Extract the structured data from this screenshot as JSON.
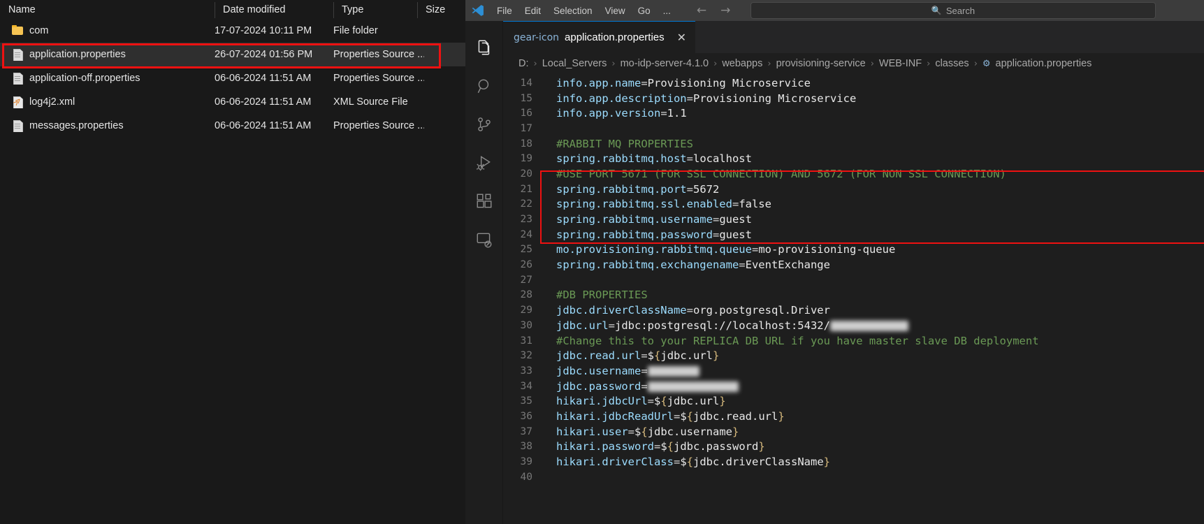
{
  "explorer": {
    "columns": [
      {
        "label": "Name"
      },
      {
        "label": "Date modified"
      },
      {
        "label": "Type"
      },
      {
        "label": "Size"
      }
    ],
    "rows": [
      {
        "name": "com",
        "date": "17-07-2024 10:11 PM",
        "type": "File folder",
        "size": "",
        "icon": "folder-icon",
        "selected": false
      },
      {
        "name": "application.properties",
        "date": "26-07-2024 01:56 PM",
        "type": "Properties Source ...",
        "size": "",
        "icon": "document-icon",
        "selected": true
      },
      {
        "name": "application-off.properties",
        "date": "06-06-2024 11:51 AM",
        "type": "Properties Source ...",
        "size": "",
        "icon": "document-icon",
        "selected": false
      },
      {
        "name": "log4j2.xml",
        "date": "06-06-2024 11:51 AM",
        "type": "XML Source File",
        "size": "",
        "icon": "xml-icon",
        "selected": false
      },
      {
        "name": "messages.properties",
        "date": "06-06-2024 11:51 AM",
        "type": "Properties Source ...",
        "size": "",
        "icon": "document-icon",
        "selected": false
      }
    ]
  },
  "vscode": {
    "menu": [
      "File",
      "Edit",
      "Selection",
      "View",
      "Go",
      "..."
    ],
    "nav": {
      "back": "←",
      "forward": "→"
    },
    "search": {
      "placeholder": "Search",
      "icon": "search-icon"
    },
    "activity_bar": [
      {
        "name": "explorer-icon",
        "active": true
      },
      {
        "name": "search-icon",
        "active": false
      },
      {
        "name": "source-control-icon",
        "active": false
      },
      {
        "name": "run-debug-icon",
        "active": false
      },
      {
        "name": "extensions-icon",
        "active": false
      },
      {
        "name": "remote-explorer-icon",
        "active": false
      }
    ],
    "tab": {
      "label": "application.properties",
      "icon": "gear-icon",
      "close": "✕"
    },
    "breadcrumb": [
      "D:",
      "Local_Servers",
      "mo-idp-server-4.1.0",
      "webapps",
      "provisioning-service",
      "WEB-INF",
      "classes",
      "application.properties"
    ],
    "breadcrumb_separator": "›",
    "highlight_color": "#ee1111",
    "code_lines": [
      {
        "num": "14",
        "segs": [
          {
            "t": "info.app.name",
            "c": "k"
          },
          {
            "t": "=",
            "c": "eq"
          },
          {
            "t": "Provisioning Microservice",
            "c": "v"
          }
        ]
      },
      {
        "num": "15",
        "segs": [
          {
            "t": "info.app.description",
            "c": "k"
          },
          {
            "t": "=",
            "c": "eq"
          },
          {
            "t": "Provisioning Microservice",
            "c": "v"
          }
        ]
      },
      {
        "num": "16",
        "segs": [
          {
            "t": "info.app.version",
            "c": "k"
          },
          {
            "t": "=",
            "c": "eq"
          },
          {
            "t": "1.1",
            "c": "v"
          }
        ]
      },
      {
        "num": "17",
        "segs": []
      },
      {
        "num": "18",
        "segs": [
          {
            "t": "#RABBIT MQ PROPERTIES",
            "c": "c"
          }
        ]
      },
      {
        "num": "19",
        "segs": [
          {
            "t": "spring.rabbitmq.host",
            "c": "k"
          },
          {
            "t": "=",
            "c": "eq"
          },
          {
            "t": "localhost",
            "c": "v"
          }
        ]
      },
      {
        "num": "20",
        "segs": [
          {
            "t": "#USE PORT 5671 (FOR SSL CONNECTION) AND 5672 (FOR NON SSL CONNECTION)",
            "c": "c"
          }
        ]
      },
      {
        "num": "21",
        "segs": [
          {
            "t": "spring.rabbitmq.port",
            "c": "k"
          },
          {
            "t": "=",
            "c": "eq"
          },
          {
            "t": "5672",
            "c": "v"
          }
        ]
      },
      {
        "num": "22",
        "segs": [
          {
            "t": "spring.rabbitmq.ssl.enabled",
            "c": "k"
          },
          {
            "t": "=",
            "c": "eq"
          },
          {
            "t": "false",
            "c": "v"
          }
        ]
      },
      {
        "num": "23",
        "segs": [
          {
            "t": "spring.rabbitmq.username",
            "c": "k"
          },
          {
            "t": "=",
            "c": "eq"
          },
          {
            "t": "guest",
            "c": "v"
          }
        ]
      },
      {
        "num": "24",
        "segs": [
          {
            "t": "spring.rabbitmq.password",
            "c": "k"
          },
          {
            "t": "=",
            "c": "eq"
          },
          {
            "t": "guest",
            "c": "v"
          }
        ]
      },
      {
        "num": "25",
        "segs": [
          {
            "t": "mo.provisioning.rabbitmq.queue",
            "c": "k"
          },
          {
            "t": "=",
            "c": "eq"
          },
          {
            "t": "mo-provisioning-queue",
            "c": "v"
          }
        ]
      },
      {
        "num": "26",
        "segs": [
          {
            "t": "spring.rabbitmq.exchangename",
            "c": "k"
          },
          {
            "t": "=",
            "c": "eq"
          },
          {
            "t": "EventExchange",
            "c": "v"
          }
        ]
      },
      {
        "num": "27",
        "segs": []
      },
      {
        "num": "28",
        "segs": [
          {
            "t": "#DB PROPERTIES",
            "c": "c"
          }
        ]
      },
      {
        "num": "29",
        "segs": [
          {
            "t": "jdbc.driverClassName",
            "c": "k"
          },
          {
            "t": "=",
            "c": "eq"
          },
          {
            "t": "org.postgresql.Driver",
            "c": "v"
          }
        ]
      },
      {
        "num": "30",
        "segs": [
          {
            "t": "jdbc.url",
            "c": "k"
          },
          {
            "t": "=",
            "c": "eq"
          },
          {
            "t": "jdbc:postgresql://localhost:5432/",
            "c": "v"
          },
          {
            "t": "microservice",
            "c": "blur"
          }
        ]
      },
      {
        "num": "31",
        "segs": [
          {
            "t": "#Change this to your REPLICA DB URL if you have master slave DB deployment",
            "c": "c"
          }
        ]
      },
      {
        "num": "32",
        "segs": [
          {
            "t": "jdbc.read.url",
            "c": "k"
          },
          {
            "t": "=",
            "c": "eq"
          },
          {
            "t": "$",
            "c": "v"
          },
          {
            "t": "{",
            "c": "br"
          },
          {
            "t": "jdbc.url",
            "c": "v"
          },
          {
            "t": "}",
            "c": "br"
          }
        ]
      },
      {
        "num": "33",
        "segs": [
          {
            "t": "jdbc.username",
            "c": "k"
          },
          {
            "t": "=",
            "c": "eq"
          },
          {
            "t": "postgres",
            "c": "blur"
          }
        ]
      },
      {
        "num": "34",
        "segs": [
          {
            "t": "jdbc.password",
            "c": "k"
          },
          {
            "t": "=",
            "c": "eq"
          },
          {
            "t": "YourJdbcPasswd",
            "c": "blur"
          }
        ]
      },
      {
        "num": "35",
        "segs": [
          {
            "t": "hikari.jdbcUrl",
            "c": "k"
          },
          {
            "t": "=",
            "c": "eq"
          },
          {
            "t": "$",
            "c": "v"
          },
          {
            "t": "{",
            "c": "br"
          },
          {
            "t": "jdbc.url",
            "c": "v"
          },
          {
            "t": "}",
            "c": "br"
          }
        ]
      },
      {
        "num": "36",
        "segs": [
          {
            "t": "hikari.jdbcReadUrl",
            "c": "k"
          },
          {
            "t": "=",
            "c": "eq"
          },
          {
            "t": "$",
            "c": "v"
          },
          {
            "t": "{",
            "c": "br"
          },
          {
            "t": "jdbc.read.url",
            "c": "v"
          },
          {
            "t": "}",
            "c": "br"
          }
        ]
      },
      {
        "num": "37",
        "segs": [
          {
            "t": "hikari.user",
            "c": "k"
          },
          {
            "t": "=",
            "c": "eq"
          },
          {
            "t": "$",
            "c": "v"
          },
          {
            "t": "{",
            "c": "br"
          },
          {
            "t": "jdbc.username",
            "c": "v"
          },
          {
            "t": "}",
            "c": "br"
          }
        ]
      },
      {
        "num": "38",
        "segs": [
          {
            "t": "hikari.password",
            "c": "k"
          },
          {
            "t": "=",
            "c": "eq"
          },
          {
            "t": "$",
            "c": "v"
          },
          {
            "t": "{",
            "c": "br"
          },
          {
            "t": "jdbc.password",
            "c": "v"
          },
          {
            "t": "}",
            "c": "br"
          }
        ]
      },
      {
        "num": "39",
        "segs": [
          {
            "t": "hikari.driverClass",
            "c": "k"
          },
          {
            "t": "=",
            "c": "eq"
          },
          {
            "t": "$",
            "c": "v"
          },
          {
            "t": "{",
            "c": "br"
          },
          {
            "t": "jdbc.driverClassName",
            "c": "v"
          },
          {
            "t": "}",
            "c": "br"
          }
        ]
      },
      {
        "num": "40",
        "segs": []
      }
    ]
  }
}
